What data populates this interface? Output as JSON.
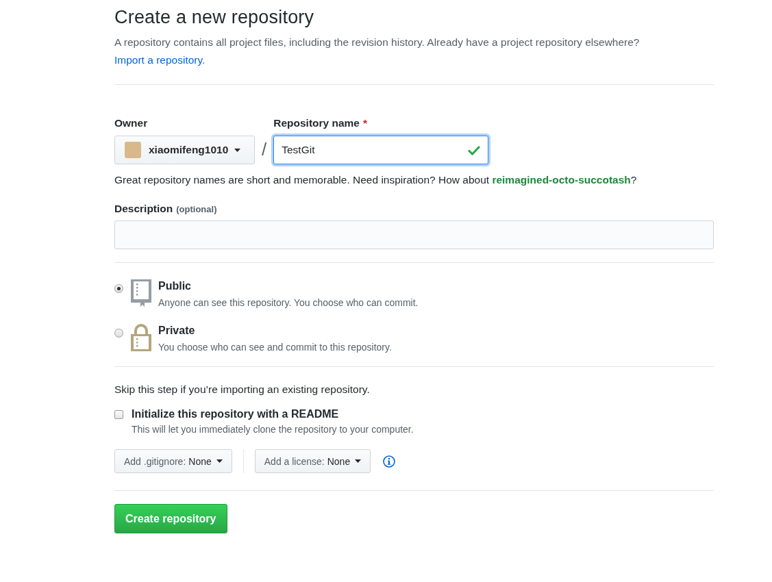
{
  "title": "Create a new repository",
  "intro": "A repository contains all project files, including the revision history. Already have a project repository elsewhere?",
  "import_link": "Import a repository.",
  "owner": {
    "label": "Owner",
    "value": "xiaomifeng1010"
  },
  "separator": "/",
  "repo_name": {
    "label": "Repository name",
    "required_mark": "*",
    "value": "TestGit",
    "valid": true
  },
  "name_hint": "Great repository names are short and memorable. Need inspiration? How about **reimagined-octo-succotash**?",
  "description": {
    "label": "Description",
    "note": "(optional)"
  },
  "visibility": [
    {
      "kind": "public",
      "label": "Public",
      "text": "Anyone can see this repository. You choose who can commit.",
      "selected": true
    },
    {
      "kind": "private",
      "label": "Private",
      "text": "You choose who can see and commit to this repository.",
      "selected": false
    }
  ],
  "skip_note": "Skip this step if you’re importing an existing repository.",
  "readme": {
    "label": "Initialize this repository with a README",
    "text": "This will let you immediately clone the repository to your computer.",
    "checked": false
  },
  "selects": [
    {
      "label": "Add .gitignore:",
      "value": "None"
    },
    {
      "label": "Add a license:",
      "value": "None"
    }
  ],
  "submit": "Create repository"
}
